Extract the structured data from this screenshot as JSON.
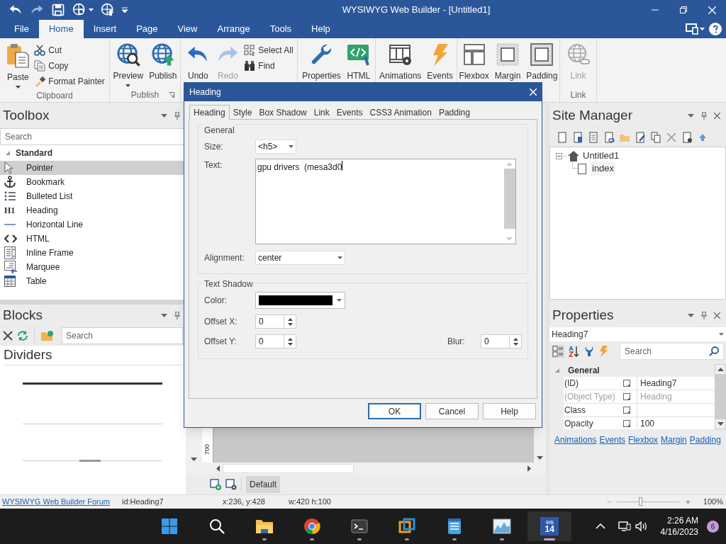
{
  "window": {
    "title": "WYSIWYG Web Builder - [Untitled1]"
  },
  "menu_tabs": [
    {
      "label": "File",
      "selected": false
    },
    {
      "label": "Home",
      "selected": true
    },
    {
      "label": "Insert",
      "selected": false
    },
    {
      "label": "Page",
      "selected": false
    },
    {
      "label": "View",
      "selected": false
    },
    {
      "label": "Arrange",
      "selected": false
    },
    {
      "label": "Tools",
      "selected": false
    },
    {
      "label": "Help",
      "selected": false
    }
  ],
  "ribbon": [
    {
      "label": "Clipboard",
      "items": [
        {
          "label": "Paste",
          "kind": "large",
          "dropdown": true,
          "disabled": false
        },
        {
          "label": "Cut",
          "kind": "small",
          "disabled": false
        },
        {
          "label": "Copy",
          "kind": "small",
          "disabled": false
        },
        {
          "label": "Format Painter",
          "kind": "small",
          "disabled": false
        }
      ]
    },
    {
      "label": "Publish",
      "items": [
        {
          "label": "Preview",
          "kind": "large",
          "dropdown": true,
          "disabled": false
        },
        {
          "label": "Publish",
          "kind": "large",
          "dropdown": false,
          "disabled": false
        }
      ]
    },
    {
      "items": [
        {
          "label": "Undo",
          "kind": "large",
          "dropdown": false,
          "disabled": false
        },
        {
          "label": "Redo",
          "kind": "large",
          "dropdown": false,
          "disabled": true
        },
        {
          "label": "Select All",
          "kind": "small",
          "disabled": false
        },
        {
          "label": "Find",
          "kind": "small",
          "disabled": false
        }
      ]
    },
    {
      "items": [
        {
          "label": "Properties",
          "kind": "large",
          "dropdown": false,
          "disabled": false
        },
        {
          "label": "HTML",
          "kind": "large",
          "dropdown": false,
          "disabled": false
        }
      ]
    },
    {
      "items": [
        {
          "label": "Animations",
          "kind": "large",
          "dropdown": false,
          "disabled": false
        },
        {
          "label": "Events",
          "kind": "large",
          "dropdown": false,
          "disabled": false
        }
      ]
    },
    {
      "items": [
        {
          "label": "Flexbox",
          "kind": "large",
          "dropdown": false,
          "disabled": false
        },
        {
          "label": "Margin",
          "kind": "large",
          "dropdown": false,
          "disabled": false
        },
        {
          "label": "Padding",
          "kind": "large",
          "dropdown": false,
          "disabled": false
        }
      ]
    },
    {
      "label": "Link",
      "items": [
        {
          "label": "Link",
          "kind": "large",
          "dropdown": false,
          "disabled": true
        }
      ]
    }
  ],
  "toolbox": {
    "title": "Toolbox",
    "search": {
      "placeholder": "Search"
    },
    "categories": [
      {
        "label": "Standard",
        "expanded": true,
        "items": [
          {
            "label": "Pointer",
            "selected": true
          },
          {
            "label": "Bookmark",
            "selected": false
          },
          {
            "label": "Bulleted List",
            "selected": false
          },
          {
            "label": "Heading",
            "selected": false,
            "icon_text": "H1"
          },
          {
            "label": "Horizontal Line",
            "selected": false
          },
          {
            "label": "HTML",
            "selected": false
          },
          {
            "label": "Inline Frame",
            "selected": false
          },
          {
            "label": "Marquee",
            "selected": false
          },
          {
            "label": "Table",
            "selected": false
          }
        ]
      }
    ]
  },
  "blocks": {
    "title": "Blocks",
    "search": {
      "placeholder": "Search"
    },
    "category": "Dividers"
  },
  "editor": {
    "ruler_label": "700",
    "page_tabs": [
      {
        "label": "Default",
        "selected": true
      }
    ]
  },
  "site_manager": {
    "title": "Site Manager",
    "tree": [
      {
        "label": "Untitled1",
        "expanded": true,
        "children": [
          {
            "label": "index"
          }
        ]
      }
    ]
  },
  "properties": {
    "title": "Properties",
    "object": "Heading7",
    "search": {
      "placeholder": "Search"
    },
    "categories": [
      {
        "label": "General",
        "expanded": true,
        "rows": [
          {
            "name": "(ID)",
            "value": "Heading7",
            "disabled": false
          },
          {
            "name": "(Object Type)",
            "value": "Heading",
            "disabled": true
          },
          {
            "name": "Class",
            "disabled": false
          },
          {
            "name": "Opacity",
            "value": "100",
            "disabled": false
          }
        ]
      }
    ],
    "links": [
      "Animations",
      "Events",
      "Flexbox",
      "Margin",
      "Padding"
    ]
  },
  "status_bar": {
    "link": "WYSIWYG Web Builder Forum",
    "id": "id:Heading7",
    "position": "x:236, y:428",
    "size": "w:420 h:100",
    "zoom": {
      "minus": "−",
      "plus": "+",
      "level": 0.35,
      "reading": "100%"
    }
  },
  "taskbar": {
    "apps": [
      {
        "running": false,
        "active": false
      },
      {
        "running": false,
        "active": false
      },
      {
        "running": true,
        "active": false
      },
      {
        "running": true,
        "active": false
      },
      {
        "running": true,
        "active": false
      },
      {
        "running": true,
        "active": false
      },
      {
        "running": true,
        "active": false
      },
      {
        "running": true,
        "active": false
      },
      {
        "running": true,
        "active": true,
        "icon_text": [
          "WB",
          "14"
        ]
      }
    ],
    "time": "2:26 AM",
    "date": "4/16/2023",
    "notifications": "6"
  },
  "dialog": {
    "title": "Heading",
    "tabs": [
      {
        "label": "Heading",
        "selected": true
      },
      {
        "label": "Style",
        "selected": false
      },
      {
        "label": "Box Shadow",
        "selected": false
      },
      {
        "label": "Link",
        "selected": false
      },
      {
        "label": "Events",
        "selected": false
      },
      {
        "label": "CSS3 Animation",
        "selected": false
      },
      {
        "label": "Padding",
        "selected": false
      }
    ],
    "general": {
      "title": "General",
      "size": {
        "label": "Size:",
        "value": "<h5>"
      },
      "text": {
        "label": "Text:",
        "value": "gpu drivers  (mesa3d0"
      },
      "alignment": {
        "label": "Alignment:",
        "value": "center"
      }
    },
    "text_shadow": {
      "title": "Text Shadow",
      "color": {
        "label": "Color:",
        "color": "#000000"
      },
      "offset_x": {
        "label": "Offset X:",
        "value": "0"
      },
      "offset_y": {
        "label": "Offset Y:",
        "value": "0"
      },
      "blur": {
        "label": "Blur:",
        "value": "0"
      }
    },
    "buttons": [
      {
        "label": "OK",
        "default": true
      },
      {
        "label": "Cancel",
        "default": false
      },
      {
        "label": "Help",
        "default": false
      }
    ]
  }
}
